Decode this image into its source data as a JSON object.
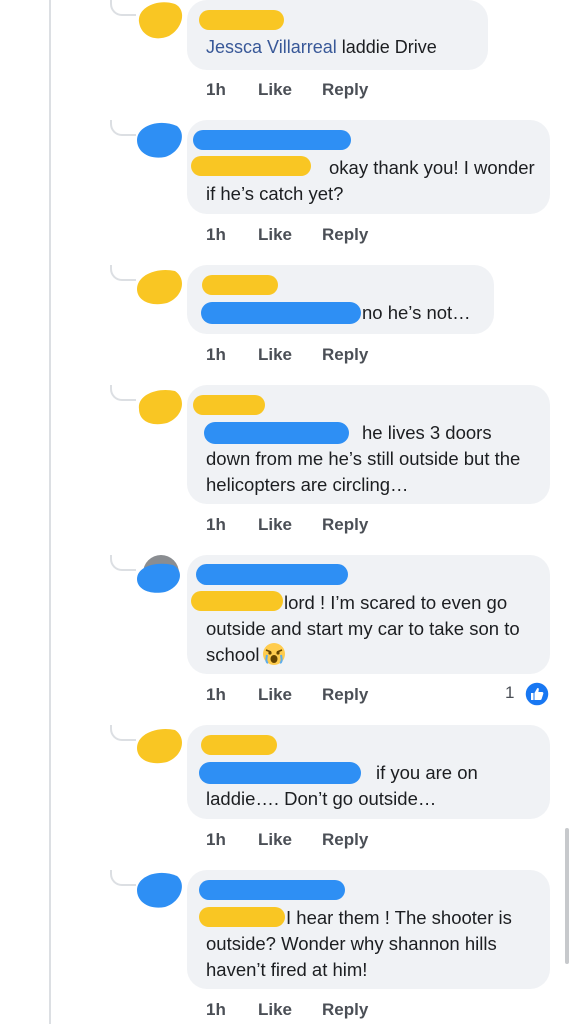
{
  "comments": [
    {
      "author": "Jessca Villarreal",
      "text": "laddie Drive",
      "time": "1h",
      "like": "Like",
      "reply": "Reply"
    },
    {
      "text": "okay thank you! I wonder if he’s catch yet?",
      "time": "1h",
      "like": "Like",
      "reply": "Reply"
    },
    {
      "text": "no he’s not…",
      "time": "1h",
      "like": "Like",
      "reply": "Reply"
    },
    {
      "text_line1": "he lives 3 doors",
      "text_rest": "down from me he’s still outside but the helicopters are circling…",
      "time": "1h",
      "like": "Like",
      "reply": "Reply"
    },
    {
      "text_line1": "lord ! I’m scared to even go",
      "text_rest": "outside and start my car to take son to school",
      "emoji": "crying-face",
      "time": "1h",
      "like": "Like",
      "reply": "Reply",
      "reaction_count": "1"
    },
    {
      "text_line1": "if you are on",
      "text_rest": "laddie…. Don’t go outside…",
      "time": "1h",
      "like": "Like",
      "reply": "Reply"
    },
    {
      "text_line1": "I hear them ! The shooter is",
      "text_rest": "outside? Wonder why shannon hills haven’t fired at him!",
      "time": "1h",
      "like": "Like",
      "reply": "Reply"
    }
  ],
  "colors": {
    "author_link": "#385898",
    "bubble": "#f0f2f5",
    "meta": "#4b4f56",
    "redaction_yellow": "#f9c623",
    "redaction_blue": "#2e8ff4",
    "like_blue": "#1877f2"
  }
}
